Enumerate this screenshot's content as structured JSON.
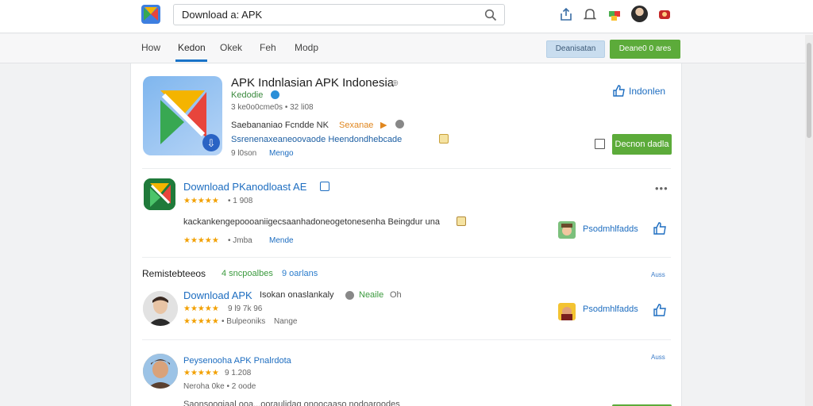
{
  "search": {
    "value": "Download a: APK"
  },
  "tabs": [
    "How",
    "Kedon",
    "Okek",
    "Feh",
    "Modp"
  ],
  "toolbar": {
    "light_button": "Deanisatan",
    "green_button": "Deane0 0 ares"
  },
  "featured": {
    "title": "APK Indnlasian APK Indonesia",
    "developer": "Kedodie",
    "meta": "3 ke0o0cme0s • 32 li08",
    "desc_line": "Saebananiao Fcndde NK",
    "desc_highlight": "Sexanae",
    "desc_blue": "Ssrenenaxeaneoovaode Heendondhebcade",
    "meta2": "9 l0son",
    "meta2_link": "Mengo",
    "follow_label": "Indonlen",
    "install_label": "Decnon dadla"
  },
  "app1": {
    "title": "Download PKanodloast AE",
    "rating_text": "• 1 908",
    "description": "kackankengepoooaniigecsaanhadoneogetonesenha Beingdur una",
    "meta_text": "• Jmba",
    "meta_link": "Mende",
    "side_link": "Psodmhlfadds"
  },
  "section": {
    "title": "Remistebteeos",
    "link_green": "4 sncpoalbes",
    "link_blue": "9 oarlans",
    "right_link": "Auss"
  },
  "app2": {
    "title": "Download APK",
    "title_rest": "Isokan onaslankaly",
    "title_green": "Neaile",
    "title_tail": "Oh",
    "rating_text": "9 l9 7k 96",
    "meta_text": "• Bulpeoniks",
    "meta_link": "Nange",
    "side_link": "Psodmhlfadds"
  },
  "app3": {
    "title": "Peysenooha APK Pnalrdota",
    "rating_text": "9 1.208",
    "meta_text": "Neroha 0ke • 2 oode",
    "right_link": "Auss",
    "partial_line": "Saonsoogiaal ooa...ooraulidag onoocaaso nodoaroodes"
  },
  "colors": {
    "accent_blue": "#1a73c8",
    "green": "#5cab3a",
    "link": "#1d6dc0",
    "star": "#f2a000"
  }
}
